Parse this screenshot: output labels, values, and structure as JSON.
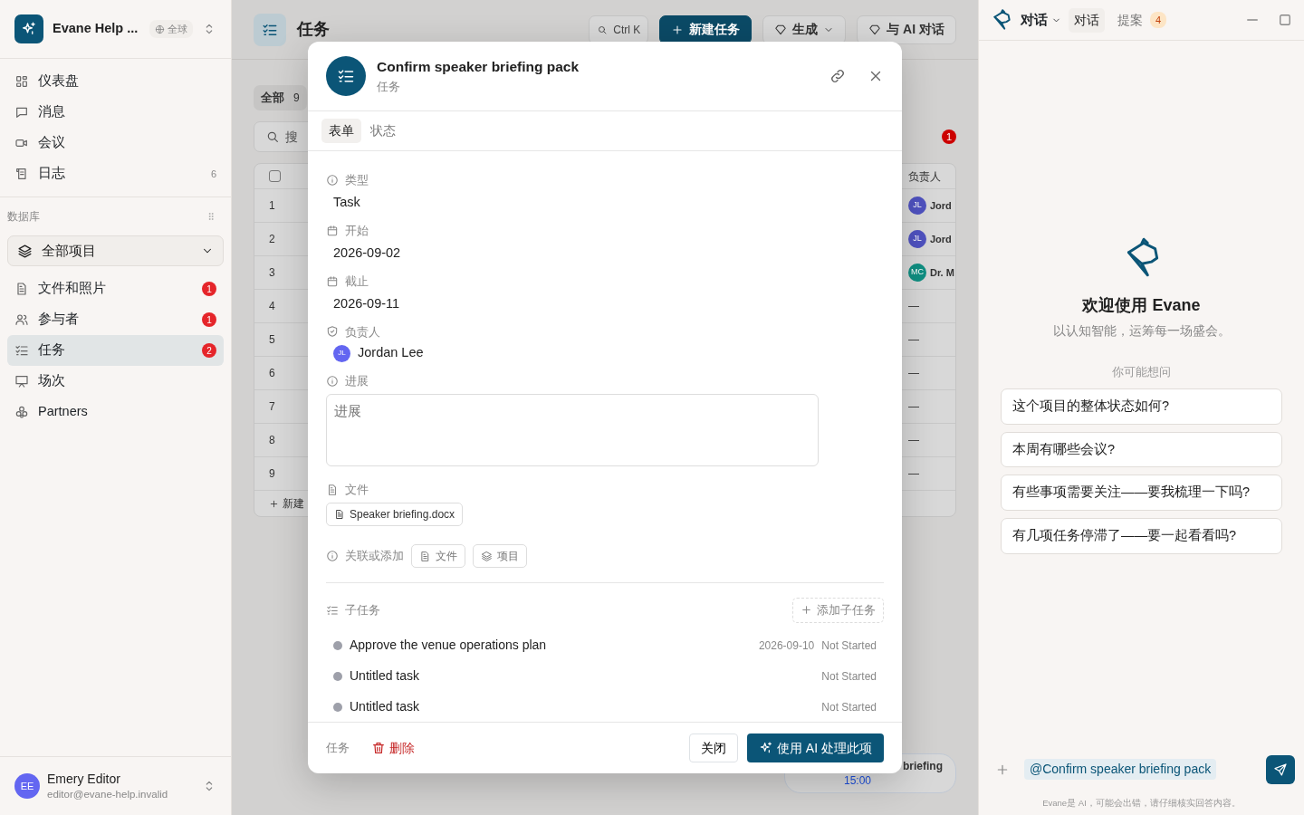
{
  "sidebar": {
    "workspace": {
      "name": "Evane Help ...",
      "scope": "全球"
    },
    "nav": [
      {
        "label": "仪表盘"
      },
      {
        "label": "消息"
      },
      {
        "label": "会议"
      },
      {
        "label": "日志",
        "count": "6"
      }
    ],
    "section_title": "数据库",
    "project_select": "全部项目",
    "items": [
      {
        "label": "文件和照片",
        "badge": "1",
        "selected": false
      },
      {
        "label": "参与者",
        "badge": "1",
        "selected": false
      },
      {
        "label": "任务",
        "badge": "2",
        "selected": true
      },
      {
        "label": "场次",
        "selected": false
      },
      {
        "label": "Partners",
        "selected": false
      }
    ],
    "user": {
      "initials": "EE",
      "name": "Emery Editor",
      "email": "editor@evane-help.invalid"
    }
  },
  "main": {
    "title": "任务",
    "search_shortcut": "Ctrl K",
    "new_button": "新建任务",
    "generate_button": "生成",
    "chat_button": "与 AI 对话",
    "filter": {
      "label": "全部",
      "count": "9"
    },
    "search_placeholder": "搜",
    "alert_count": "1",
    "table": {
      "assignee_column": "负责人",
      "select_all": {
        "checked": false
      },
      "rows": [
        {
          "number": "1",
          "assignee": {
            "initials": "JL",
            "name": "Jord",
            "color": "#4f52c0"
          }
        },
        {
          "number": "2",
          "assignee": {
            "initials": "JL",
            "name": "Jord",
            "color": "#4f52c0"
          }
        },
        {
          "number": "3",
          "assignee": {
            "initials": "MC",
            "name": "Dr. M",
            "color": "#0f8f82"
          }
        },
        {
          "number": "4",
          "empty": "—"
        },
        {
          "number": "5",
          "empty": "—"
        },
        {
          "number": "6",
          "empty": "—"
        },
        {
          "number": "7",
          "empty": "—"
        },
        {
          "number": "8",
          "empty": "—"
        },
        {
          "number": "9",
          "empty": "—"
        }
      ],
      "add_row": "新建"
    },
    "event": {
      "title": "briefing",
      "time": "15:00"
    }
  },
  "modal": {
    "title": "Confirm speaker briefing pack",
    "subtitle": "任务",
    "tabs": [
      {
        "label": "表单",
        "selected": true
      },
      {
        "label": "状态",
        "selected": false
      }
    ],
    "fields": [
      {
        "kind": "text",
        "label": "类型",
        "value": "Task"
      },
      {
        "kind": "date",
        "label": "开始",
        "value": "2026-09-02"
      },
      {
        "kind": "date",
        "label": "截止",
        "value": "2026-09-11"
      },
      {
        "kind": "person",
        "label": "负责人",
        "initials": "JL",
        "value": "Jordan Lee"
      },
      {
        "kind": "textarea",
        "label": "进展",
        "placeholder": "进展"
      },
      {
        "kind": "file",
        "label": "文件",
        "value": "Speaker briefing.docx"
      }
    ],
    "links": {
      "label": "关联或添加",
      "buttons": [
        "文件",
        "项目"
      ]
    },
    "subtasks": {
      "title": "子任务",
      "add": "添加子任务",
      "items": [
        {
          "title": "Approve the venue operations plan",
          "due": "2026-09-10",
          "status": "Not Started"
        },
        {
          "title": "Untitled task",
          "status": "Not Started"
        },
        {
          "title": "Untitled task",
          "status": "Not Started"
        }
      ]
    },
    "footer": {
      "type": "任务",
      "delete": "删除",
      "close": "关闭",
      "ai": "使用 AI 处理此项"
    }
  },
  "assistant": {
    "title": "对话",
    "tabs": [
      {
        "label": "对话",
        "selected": true
      },
      {
        "label": "提案",
        "count": "4",
        "selected": false
      }
    ],
    "welcome": "欢迎使用 Evane",
    "tagline": "以认知智能，运筹每一场盛会。",
    "suggest_title": "你可能想问",
    "suggestions": [
      "这个项目的整体状态如何?",
      "本周有哪些会议?",
      "有些事项需要关注——要我梳理一下吗?",
      "有几项任务停滞了——要一起看看吗?"
    ],
    "mention": "@Confirm speaker briefing pack",
    "disclaimer": "Evane是 AI，可能会出错，请仔细核实回答内容。"
  }
}
